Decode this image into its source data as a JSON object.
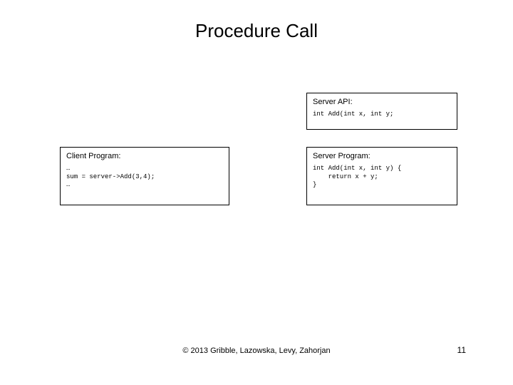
{
  "title": "Procedure Call",
  "api": {
    "title": "Server API:",
    "code": "int Add(int x, int y;"
  },
  "client": {
    "title": "Client Program:",
    "code": "…\nsum = server->Add(3,4);\n…"
  },
  "server": {
    "title": "Server Program:",
    "code": "int Add(int x, int y) {\n    return x + y;\n}"
  },
  "footer": "© 2013 Gribble, Lazowska, Levy, Zahorjan",
  "page": "11"
}
